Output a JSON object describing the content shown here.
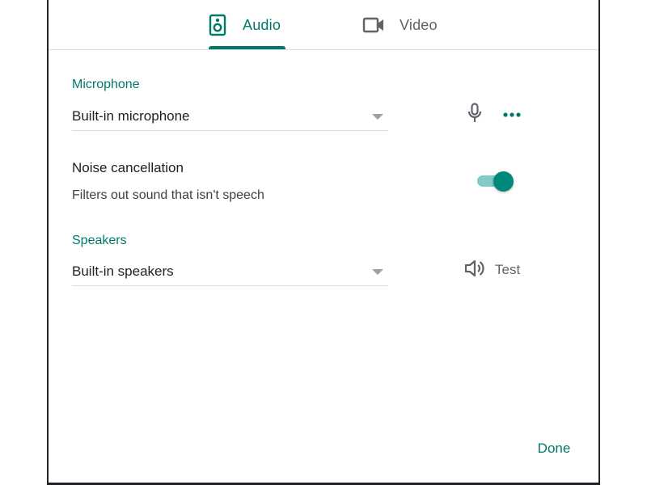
{
  "tabs": [
    {
      "label": "Audio",
      "icon": "speaker-icon",
      "selected": true
    },
    {
      "label": "Video",
      "icon": "video-camera-icon",
      "selected": false
    }
  ],
  "microphone": {
    "section_label": "Microphone",
    "selected_value": "Built-in microphone"
  },
  "noise_cancellation": {
    "title": "Noise cancellation",
    "description": "Filters out sound that isn't speech",
    "enabled": true
  },
  "speakers": {
    "section_label": "Speakers",
    "selected_value": "Built-in speakers",
    "test_label": "Test"
  },
  "footer": {
    "done_label": "Done"
  },
  "colors": {
    "accent": "#00796b",
    "toggle_track": "#80cbc4",
    "icon_gray": "#5f6368"
  }
}
